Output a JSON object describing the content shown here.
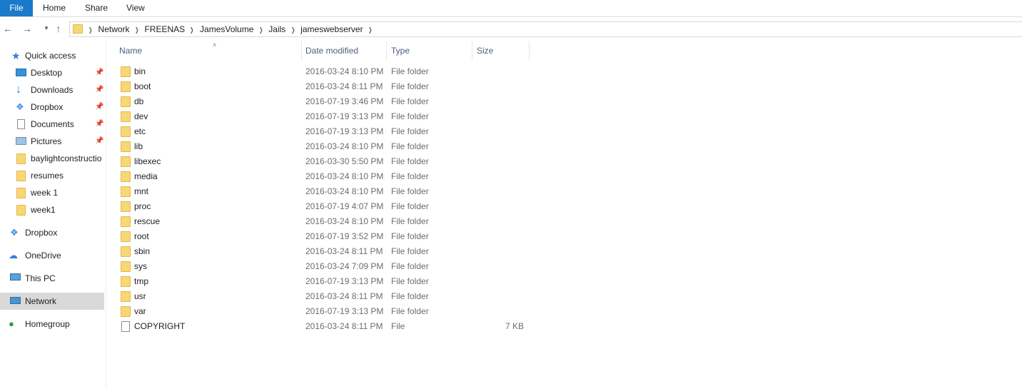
{
  "ribbon": {
    "tabs": [
      "File",
      "Home",
      "Share",
      "View"
    ]
  },
  "nav_icons": {
    "back": "back-arrow-icon",
    "forward": "forward-arrow-icon",
    "recent": "chevron-down-icon",
    "up": "up-arrow-icon"
  },
  "breadcrumb": [
    "Network",
    "FREENAS",
    "JamesVolume",
    "Jails",
    "jameswebserver"
  ],
  "sidebar": {
    "quick_access": "Quick access",
    "pinned": [
      "Desktop",
      "Downloads",
      "Dropbox",
      "Documents",
      "Pictures"
    ],
    "folders": [
      "baylightconstructio",
      "resumes",
      "week 1",
      "week1"
    ],
    "roots": [
      "Dropbox",
      "OneDrive",
      "This PC",
      "Network",
      "Homegroup"
    ],
    "selected": "Network"
  },
  "columns": {
    "name": "Name",
    "date": "Date modified",
    "type": "Type",
    "size": "Size"
  },
  "files": [
    {
      "name": "bin",
      "date": "2016-03-24 8:10 PM",
      "type": "File folder",
      "size": ""
    },
    {
      "name": "boot",
      "date": "2016-03-24 8:11 PM",
      "type": "File folder",
      "size": ""
    },
    {
      "name": "db",
      "date": "2016-07-19 3:46 PM",
      "type": "File folder",
      "size": ""
    },
    {
      "name": "dev",
      "date": "2016-07-19 3:13 PM",
      "type": "File folder",
      "size": ""
    },
    {
      "name": "etc",
      "date": "2016-07-19 3:13 PM",
      "type": "File folder",
      "size": ""
    },
    {
      "name": "lib",
      "date": "2016-03-24 8:10 PM",
      "type": "File folder",
      "size": ""
    },
    {
      "name": "libexec",
      "date": "2016-03-30 5:50 PM",
      "type": "File folder",
      "size": ""
    },
    {
      "name": "media",
      "date": "2016-03-24 8:10 PM",
      "type": "File folder",
      "size": ""
    },
    {
      "name": "mnt",
      "date": "2016-03-24 8:10 PM",
      "type": "File folder",
      "size": ""
    },
    {
      "name": "proc",
      "date": "2016-07-19 4:07 PM",
      "type": "File folder",
      "size": ""
    },
    {
      "name": "rescue",
      "date": "2016-03-24 8:10 PM",
      "type": "File folder",
      "size": ""
    },
    {
      "name": "root",
      "date": "2016-07-19 3:52 PM",
      "type": "File folder",
      "size": ""
    },
    {
      "name": "sbin",
      "date": "2016-03-24 8:11 PM",
      "type": "File folder",
      "size": ""
    },
    {
      "name": "sys",
      "date": "2016-03-24 7:09 PM",
      "type": "File folder",
      "size": ""
    },
    {
      "name": "tmp",
      "date": "2016-07-19 3:13 PM",
      "type": "File folder",
      "size": ""
    },
    {
      "name": "usr",
      "date": "2016-03-24 8:11 PM",
      "type": "File folder",
      "size": ""
    },
    {
      "name": "var",
      "date": "2016-07-19 3:13 PM",
      "type": "File folder",
      "size": ""
    },
    {
      "name": "COPYRIGHT",
      "date": "2016-03-24 8:11 PM",
      "type": "File",
      "size": "7 KB"
    }
  ]
}
